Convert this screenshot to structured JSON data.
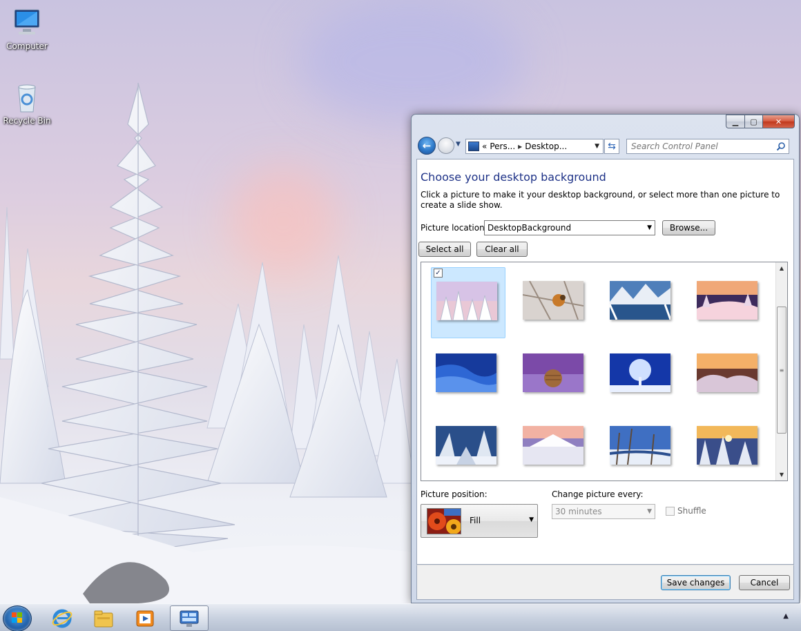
{
  "desktop": {
    "icons": [
      {
        "label": "Computer",
        "icon": "computer-icon"
      },
      {
        "label": "Recycle Bin",
        "icon": "recycle-bin-icon"
      }
    ]
  },
  "window": {
    "caption_buttons": {
      "minimize": "minimize-icon",
      "maximize": "maximize-icon",
      "close": "close-icon"
    },
    "navigation": {
      "breadcrumb": [
        "«",
        "Pers...",
        "Desktop..."
      ],
      "search_placeholder": "Search Control Panel"
    },
    "title": "Choose your desktop background",
    "description": "Click a picture to make it your desktop background, or select more than one picture to create a slide show.",
    "picture_location": {
      "label": "Picture location:",
      "value": "DesktopBackground",
      "browse_label": "Browse..."
    },
    "buttons": {
      "select_all": "Select all",
      "clear_all": "Clear all",
      "save": "Save changes",
      "cancel": "Cancel"
    },
    "gallery": {
      "selected_index": 0,
      "check": "✓",
      "thumbnails": [
        {
          "name": "snowy-trees-pink-sky"
        },
        {
          "name": "bird-on-frosted-branch"
        },
        {
          "name": "mountain-lake"
        },
        {
          "name": "snowy-hill-sunset"
        },
        {
          "name": "blue-snow-dunes"
        },
        {
          "name": "hay-bale-purple-sky"
        },
        {
          "name": "frosted-tree-blue-night"
        },
        {
          "name": "icy-shore-sunset"
        },
        {
          "name": "sunlit-frozen-trees"
        },
        {
          "name": "misty-mountain-snowfield"
        },
        {
          "name": "winter-river-trees"
        },
        {
          "name": "snowy-forest-sunrise"
        }
      ]
    },
    "picture_position": {
      "label": "Picture position:",
      "value": "Fill"
    },
    "change_picture": {
      "label": "Change picture every:",
      "value": "30 minutes"
    },
    "shuffle_label": "Shuffle"
  },
  "taskbar": {
    "items": [
      {
        "name": "start-button"
      },
      {
        "name": "internet-explorer-icon"
      },
      {
        "name": "windows-explorer-icon"
      },
      {
        "name": "media-player-icon"
      },
      {
        "name": "control-panel-icon"
      }
    ],
    "tray_arrow": "▲"
  }
}
